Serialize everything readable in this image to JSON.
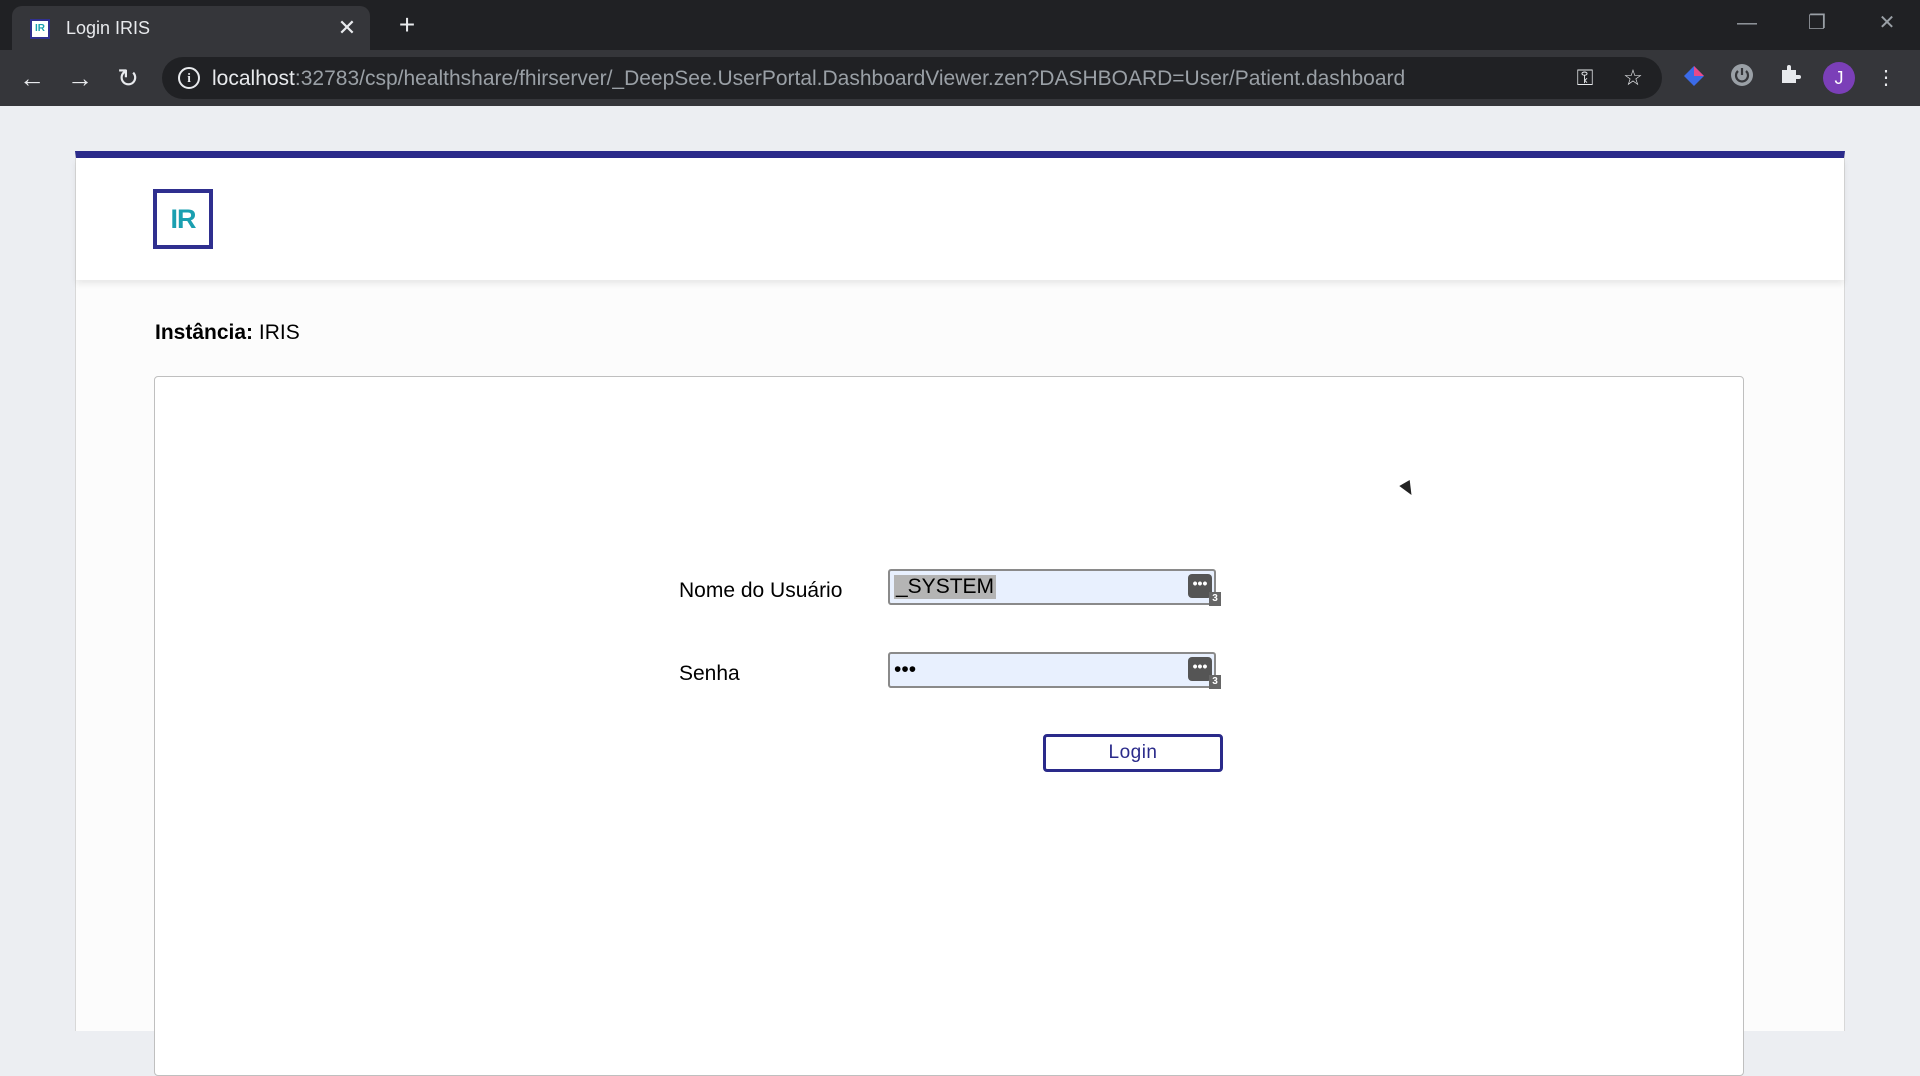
{
  "browser": {
    "tab_title": "Login IRIS",
    "tab_favicon_text": "IR",
    "close_glyph": "✕",
    "new_tab_glyph": "+",
    "url_host": "localhost",
    "url_path": ":32783/csp/healthshare/fhirserver/_DeepSee.UserPortal.DashboardViewer.zen?DASHBOARD=User/Patient.dashboard",
    "avatar_letter": "J"
  },
  "page": {
    "logo_text": "IR",
    "instance_label": "Instância:",
    "instance_value": "IRIS",
    "username_label": "Nome do Usuário",
    "username_value": "_SYSTEM",
    "password_label": "Senha",
    "password_value": "•••",
    "password_manager_badge": "3",
    "login_button": "Login"
  },
  "colors": {
    "accent": "#2a2a8a",
    "logo_text": "#1a9fb0",
    "autofill_bg": "#e8f0fe"
  }
}
